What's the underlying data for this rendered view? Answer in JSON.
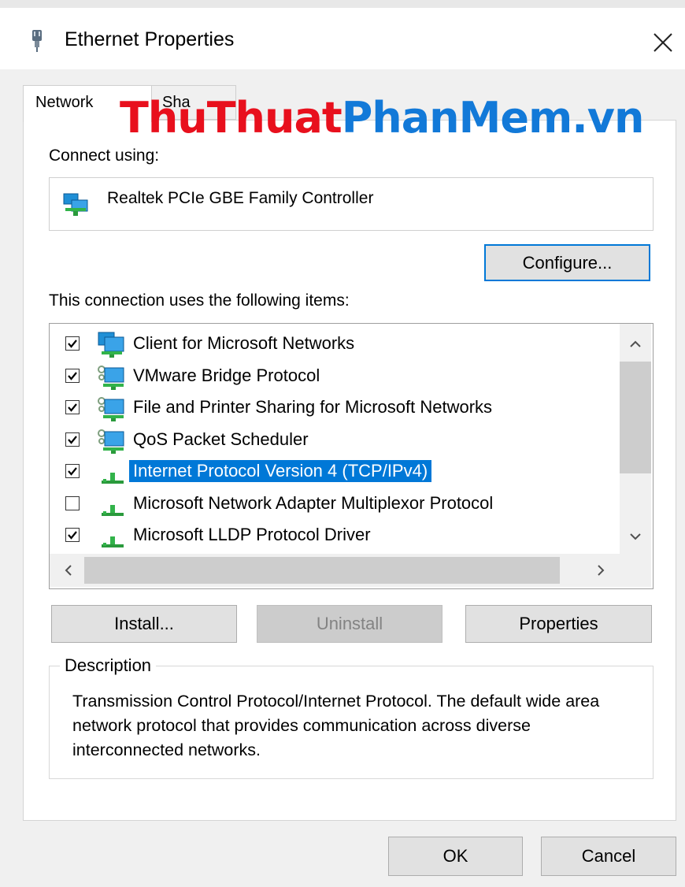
{
  "window": {
    "title": "Ethernet Properties",
    "close_glyph": "✕"
  },
  "tabs": [
    {
      "label": "Networking",
      "visible_text": "Network",
      "active": true
    },
    {
      "label": "Sharing",
      "visible_text": "Sha",
      "active": false
    }
  ],
  "watermark": {
    "part1": "ThuThuat",
    "part2": "PhanMem.vn",
    "color1": "#e8101d",
    "color2": "#1279d8"
  },
  "connect_using": {
    "label": "Connect using:",
    "adapter_name": "Realtek PCIe GBE Family Controller",
    "adapter_icon": "network-adapter-icon"
  },
  "configure_button": "Configure...",
  "items_label": "This connection uses the following items:",
  "items": [
    {
      "label": "Client for Microsoft Networks",
      "checked": true,
      "icon": "network-client-icon",
      "selected": false
    },
    {
      "label": "VMware Bridge Protocol",
      "checked": true,
      "icon": "network-service-icon",
      "selected": false
    },
    {
      "label": "File and Printer Sharing for Microsoft Networks",
      "checked": true,
      "icon": "network-service-icon",
      "selected": false
    },
    {
      "label": "QoS Packet Scheduler",
      "checked": true,
      "icon": "network-service-icon",
      "selected": false
    },
    {
      "label": "Internet Protocol Version 4 (TCP/IPv4)",
      "checked": true,
      "icon": "protocol-icon",
      "selected": true
    },
    {
      "label": "Microsoft Network Adapter Multiplexor Protocol",
      "checked": false,
      "icon": "protocol-icon",
      "selected": false
    },
    {
      "label": "Microsoft LLDP Protocol Driver",
      "checked": true,
      "icon": "protocol-icon",
      "selected": false
    }
  ],
  "scroll_arrows": {
    "up": "⌃",
    "down": "⌄",
    "left": "<",
    "right": ">"
  },
  "buttons": {
    "install": "Install...",
    "uninstall": "Uninstall",
    "properties": "Properties",
    "ok": "OK",
    "cancel": "Cancel"
  },
  "description": {
    "legend": "Description",
    "text": "Transmission Control Protocol/Internet Protocol. The default wide area network protocol that provides communication across diverse interconnected networks."
  },
  "colors": {
    "selection": "#0078d7",
    "dialog_bg": "#f0f0f0",
    "disabled_text": "#838383"
  }
}
